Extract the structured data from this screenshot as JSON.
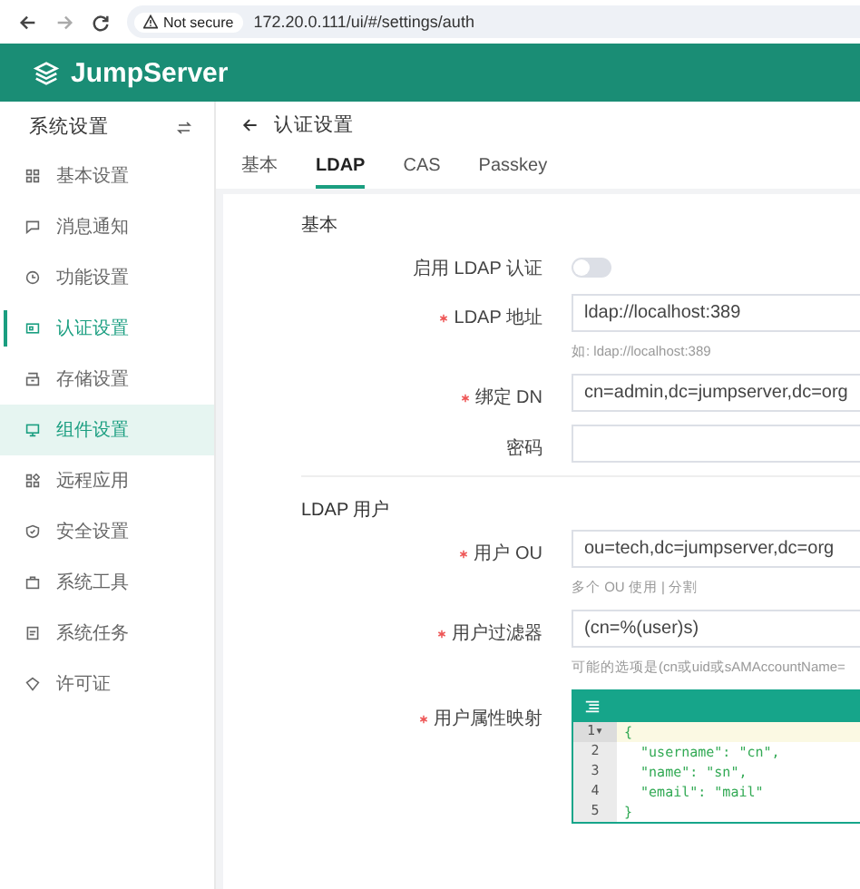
{
  "browser": {
    "security": "Not secure",
    "url": "172.20.0.111/ui/#/settings/auth"
  },
  "header": {
    "brand": "JumpServer"
  },
  "sidebar": {
    "title": "系统设置",
    "items": [
      {
        "label": "基本设置",
        "selected": false,
        "hovered": false
      },
      {
        "label": "消息通知",
        "selected": false,
        "hovered": false
      },
      {
        "label": "功能设置",
        "selected": false,
        "hovered": false
      },
      {
        "label": "认证设置",
        "selected": true,
        "hovered": false
      },
      {
        "label": "存储设置",
        "selected": false,
        "hovered": false
      },
      {
        "label": "组件设置",
        "selected": false,
        "hovered": true
      },
      {
        "label": "远程应用",
        "selected": false,
        "hovered": false
      },
      {
        "label": "安全设置",
        "selected": false,
        "hovered": false
      },
      {
        "label": "系统工具",
        "selected": false,
        "hovered": false
      },
      {
        "label": "系统任务",
        "selected": false,
        "hovered": false
      },
      {
        "label": "许可证",
        "selected": false,
        "hovered": false
      }
    ]
  },
  "page": {
    "title": "认证设置",
    "tabs": [
      {
        "label": "基本",
        "selected": false
      },
      {
        "label": "LDAP",
        "selected": true
      },
      {
        "label": "CAS",
        "selected": false
      },
      {
        "label": "Passkey",
        "selected": false
      }
    ]
  },
  "sections": [
    {
      "title": "基本",
      "fields": [
        {
          "kind": "toggle",
          "label": "启用 LDAP 认证",
          "required": false,
          "on": false
        },
        {
          "kind": "input",
          "label": "LDAP 地址",
          "required": true,
          "value": "ldap://localhost:389",
          "help": "如: ldap://localhost:389"
        },
        {
          "kind": "input",
          "label": "绑定 DN",
          "required": true,
          "value": "cn=admin,dc=jumpserver,dc=org"
        },
        {
          "kind": "input",
          "label": "密码",
          "required": false
        }
      ]
    },
    {
      "title": "LDAP 用户",
      "fields": [
        {
          "kind": "input",
          "label": "用户 OU",
          "required": true,
          "value": "ou=tech,dc=jumpserver,dc=org",
          "help": "多个 OU 使用 | 分割"
        },
        {
          "kind": "input",
          "label": "用户过滤器",
          "required": true,
          "value": "(cn=%(user)s)",
          "help": "可能的选项是(cn或uid或sAMAccountName="
        },
        {
          "kind": "code",
          "label": "用户属性映射",
          "required": true,
          "lines": [
            {
              "number": "1",
              "fold": "▾",
              "text": "{",
              "highlighted": true
            },
            {
              "number": "2",
              "text": "  \"username\": \"cn\",",
              "highlighted": false
            },
            {
              "number": "3",
              "text": "  \"name\": \"sn\",",
              "highlighted": false
            },
            {
              "number": "4",
              "text": "  \"email\": \"mail\"",
              "highlighted": false
            },
            {
              "number": "5",
              "text": "}",
              "highlighted": false
            }
          ]
        }
      ]
    }
  ]
}
